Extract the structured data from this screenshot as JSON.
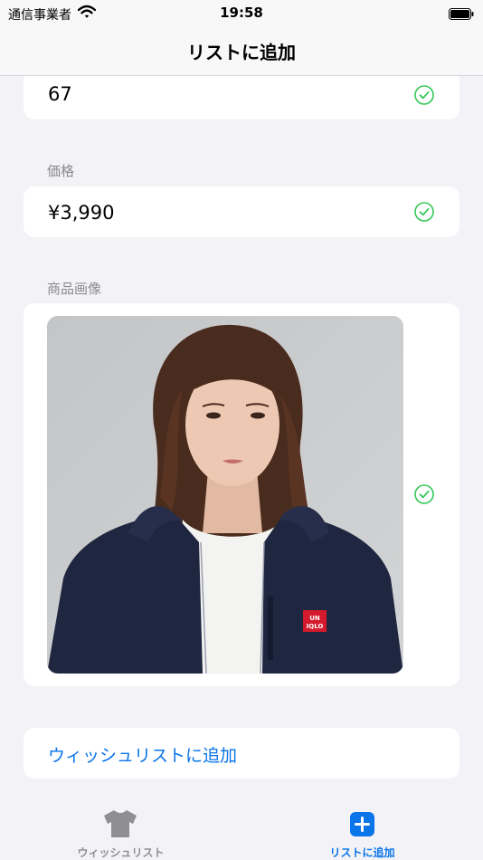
{
  "status_bar": {
    "carrier": "通信事業者",
    "time": "19:58"
  },
  "nav": {
    "title": "リストに追加"
  },
  "form": {
    "top_field_value": "67",
    "price": {
      "label": "価格",
      "value": "¥3,990"
    },
    "image": {
      "label": "商品画像"
    },
    "submit_label": "ウィッシュリストに追加"
  },
  "product_logo": "UNIQLO",
  "tabs": [
    {
      "label": "ウィッシュリスト",
      "icon": "tshirt-icon",
      "active": false
    },
    {
      "label": "リストに追加",
      "icon": "plus-square-icon",
      "active": true
    }
  ],
  "colors": {
    "accent": "#0a74e9",
    "check_green": "#34c759",
    "inactive_gray": "#8e8e93",
    "background": "#f2f2f7"
  }
}
